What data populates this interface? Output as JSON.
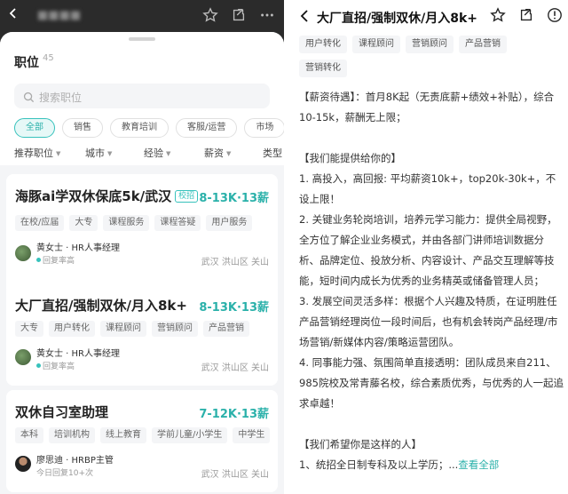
{
  "left": {
    "sheet": {
      "title": "职位",
      "count": "45",
      "search_placeholder": "搜索职位",
      "chips": [
        "全部",
        "销售",
        "教育培训",
        "客服/运营",
        "市场"
      ],
      "filters": [
        "推荐职位",
        "城市",
        "经验",
        "薪资",
        "类型"
      ]
    },
    "jobs": [
      {
        "title": "海豚ai学双休保底5k/武汉",
        "badge": "校招",
        "salary": "8-13K·13薪",
        "tags": [
          "在校/应届",
          "大专",
          "课程服务",
          "课程答疑",
          "用户服务"
        ],
        "recruiter": "黄女士 · HR人事经理",
        "status": "回复率高",
        "location": "武汉 洪山区 关山"
      },
      {
        "title": "大厂直招/强制双休/月入8k+",
        "salary": "8-13K·13薪",
        "tags": [
          "大专",
          "用户转化",
          "课程顾问",
          "营销顾问",
          "产品营销"
        ],
        "recruiter": "黄女士 · HR人事经理",
        "status": "回复率高",
        "location": "武汉 洪山区 关山"
      },
      {
        "title": "双休自习室助理",
        "salary": "7-12K·13薪",
        "tags": [
          "本科",
          "培训机构",
          "线上教育",
          "学前儿童/小学生",
          "中学生"
        ],
        "recruiter": "廖思迪 · HRBP主管",
        "status": "今日回复10+次",
        "location": "武汉 洪山区 关山"
      }
    ]
  },
  "right": {
    "title": "大厂直招/强制双休/月入8k+",
    "tags_row1": [
      "用户转化",
      "课程顾问",
      "营销顾问",
      "产品营销"
    ],
    "tags_row2": [
      "营销转化"
    ],
    "desc": [
      "【薪资待遇】：首月8K起（无责底薪+绩效+补贴），综合10-15k，薪酬无上限；",
      "",
      "【我们能提供给你的】",
      "1. 高投入，高回报: 平均薪资10k+，top20k-30k+，不设上限！",
      "2. 关键业务轮岗培训，培养元学习能力：提供全局视野，全方位了解企业业务模式，并由各部门讲师培训数据分析、品牌定位、投放分析、内容设计、产品交互理解等技能，短时间内成长为优秀的业务精英或储备管理人员；",
      "3. 发展空间灵活多样：根据个人兴趣及特质，在证明胜任产品营销经理岗位一段时间后，也有机会转岗产品经理/市场营销/新媒体内容/策略运营团队。",
      "4. 同事能力强、氛围简单直接透明：团队成员来自211、985院校及常青藤名校，综合素质优秀，与优秀的人一起追求卓越！",
      "",
      "【我们希望你是这样的人】"
    ],
    "last_line": "1、统招全日制专科及以上学历；...",
    "more_label": "查看全部"
  },
  "colors": {
    "accent": "#2bb1aa",
    "chip_active_bg": "#e6f8f7"
  }
}
